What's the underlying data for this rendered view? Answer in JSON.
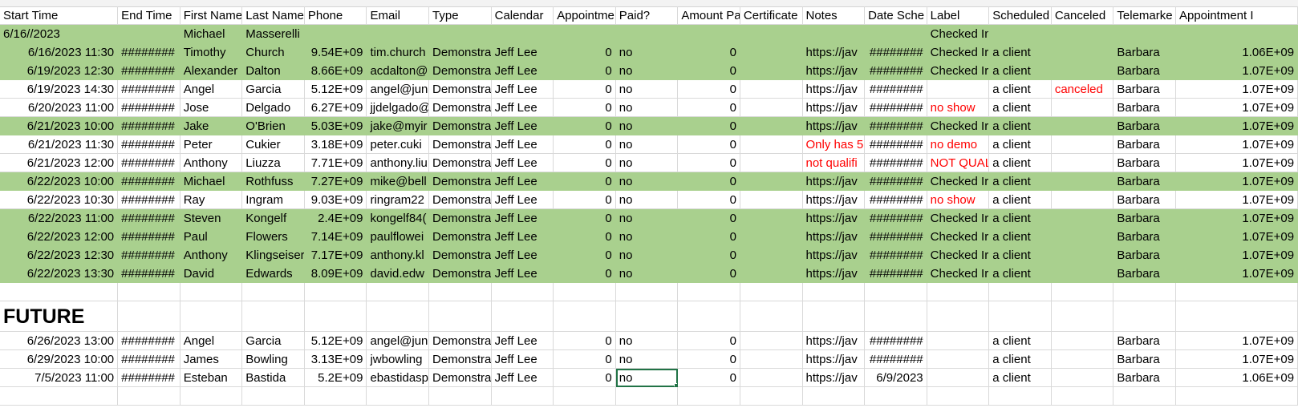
{
  "headers": [
    "Start Time",
    "End Time",
    "First Name",
    "Last Name",
    "Phone",
    "Email",
    "Type",
    "Calendar",
    "Appointme",
    "Paid?",
    "Amount Pa",
    "Certificate",
    "Notes",
    "Date Sche",
    "Label",
    "Scheduled",
    "Canceled",
    "Telemarke",
    "Appointment I"
  ],
  "section_future": "FUTURE",
  "rows": [
    {
      "start": "6/16//2023",
      "end": "",
      "first": "Michael",
      "last": "Masserelli",
      "phone": "",
      "email": "",
      "type": "",
      "cal": "",
      "appt": "",
      "paid": "",
      "amount": "",
      "cert": "",
      "notes": "",
      "date": "",
      "label": "Checked In",
      "sched": "",
      "canceled": "",
      "tele": "",
      "apptid": "",
      "green": true,
      "indent": false
    },
    {
      "start": "6/16/2023 11:30",
      "end": "########",
      "first": "Timothy",
      "last": "Church",
      "phone": "9.54E+09",
      "email": "tim.church",
      "type": "Demonstra",
      "cal": "Jeff Lee",
      "appt": "0",
      "paid": "no",
      "amount": "0",
      "cert": "",
      "notes": "https://jav",
      "date": "########",
      "label": "Checked Ir",
      "sched": "a client",
      "canceled": "",
      "tele": "Barbara",
      "apptid": "1.06E+09",
      "green": true
    },
    {
      "start": "6/19/2023 12:30",
      "end": "########",
      "first": "Alexander",
      "last": "Dalton",
      "phone": "8.66E+09",
      "email": "acdalton@",
      "type": "Demonstra",
      "cal": "Jeff Lee",
      "appt": "0",
      "paid": "no",
      "amount": "0",
      "cert": "",
      "notes": "https://jav",
      "date": "########",
      "label": "Checked Ir",
      "sched": "a client",
      "canceled": "",
      "tele": "Barbara",
      "apptid": "1.07E+09",
      "green": true
    },
    {
      "start": "6/19/2023 14:30",
      "end": "########",
      "first": "Angel",
      "last": "Garcia",
      "phone": "5.12E+09",
      "email": "angel@jun",
      "type": "Demonstra",
      "cal": "Jeff Lee",
      "appt": "0",
      "paid": "no",
      "amount": "0",
      "cert": "",
      "notes": "https://jav",
      "date": "########",
      "label": "",
      "sched": "a client",
      "canceled": "canceled",
      "tele": "Barbara",
      "apptid": "1.07E+09",
      "green": false
    },
    {
      "start": "6/20/2023 11:00",
      "end": "########",
      "first": "Jose",
      "last": "Delgado",
      "phone": "6.27E+09",
      "email": "jjdelgado@",
      "type": "Demonstra",
      "cal": "Jeff Lee",
      "appt": "0",
      "paid": "no",
      "amount": "0",
      "cert": "",
      "notes": "https://jav",
      "date": "########",
      "label": "no show",
      "sched": "a client",
      "canceled": "",
      "tele": "Barbara",
      "apptid": "1.07E+09",
      "green": false,
      "labelRed": true
    },
    {
      "start": "6/21/2023 10:00",
      "end": "########",
      "first": "Jake",
      "last": "O'Brien",
      "phone": "5.03E+09",
      "email": "jake@myir",
      "type": "Demonstra",
      "cal": "Jeff Lee",
      "appt": "0",
      "paid": "no",
      "amount": "0",
      "cert": "",
      "notes": "https://jav",
      "date": "########",
      "label": "Checked Ir",
      "sched": "a client",
      "canceled": "",
      "tele": "Barbara",
      "apptid": "1.07E+09",
      "green": true
    },
    {
      "start": "6/21/2023 11:30",
      "end": "########",
      "first": "Peter",
      "last": "Cukier",
      "phone": "3.18E+09",
      "email": "peter.cuki",
      "type": "Demonstra",
      "cal": "Jeff Lee",
      "appt": "0",
      "paid": "no",
      "amount": "0",
      "cert": "",
      "notes": "Only has 5",
      "date": "########",
      "label": "no demo",
      "sched": "a client",
      "canceled": "",
      "tele": "Barbara",
      "apptid": "1.07E+09",
      "green": false,
      "labelRed": true,
      "notesRed": true
    },
    {
      "start": "6/21/2023 12:00",
      "end": "########",
      "first": "Anthony",
      "last": "Liuzza",
      "phone": "7.71E+09",
      "email": "anthony.liu",
      "type": "Demonstra",
      "cal": "Jeff Lee",
      "appt": "0",
      "paid": "no",
      "amount": "0",
      "cert": "",
      "notes": " not qualifi",
      "date": "########",
      "label": "NOT QUAL",
      "sched": "a client",
      "canceled": "",
      "tele": "Barbara",
      "apptid": "1.07E+09",
      "green": false,
      "labelRed": true,
      "notesRed": true
    },
    {
      "start": "6/22/2023 10:00",
      "end": "########",
      "first": "Michael",
      "last": "Rothfuss",
      "phone": "7.27E+09",
      "email": "mike@bell",
      "type": "Demonstra",
      "cal": "Jeff Lee",
      "appt": "0",
      "paid": "no",
      "amount": "0",
      "cert": "",
      "notes": "https://jav",
      "date": "########",
      "label": "Checked Ir",
      "sched": "a client",
      "canceled": "",
      "tele": "Barbara",
      "apptid": "1.07E+09",
      "green": true
    },
    {
      "start": "6/22/2023 10:30",
      "end": "########",
      "first": "Ray",
      "last": "Ingram",
      "phone": "9.03E+09",
      "email": "ringram22",
      "type": "Demonstra",
      "cal": "Jeff Lee",
      "appt": "0",
      "paid": "no",
      "amount": "0",
      "cert": "",
      "notes": "https://jav",
      "date": "########",
      "label": "no show",
      "sched": "a client",
      "canceled": "",
      "tele": "Barbara",
      "apptid": "1.07E+09",
      "green": false,
      "labelRed": true
    },
    {
      "start": "6/22/2023 11:00",
      "end": "########",
      "first": "Steven",
      "last": "Kongelf",
      "phone": "2.4E+09",
      "email": "kongelf84(",
      "type": "Demonstra",
      "cal": "Jeff Lee",
      "appt": "0",
      "paid": "no",
      "amount": "0",
      "cert": "",
      "notes": "https://jav",
      "date": "########",
      "label": "Checked Ir",
      "sched": "a client",
      "canceled": "",
      "tele": "Barbara",
      "apptid": "1.07E+09",
      "green": true
    },
    {
      "start": "6/22/2023 12:00",
      "end": "########",
      "first": "Paul",
      "last": "Flowers",
      "phone": "7.14E+09",
      "email": "paulflowei",
      "type": "Demonstra",
      "cal": "Jeff Lee",
      "appt": "0",
      "paid": "no",
      "amount": "0",
      "cert": "",
      "notes": "https://jav",
      "date": "########",
      "label": "Checked Ir",
      "sched": "a client",
      "canceled": "",
      "tele": "Barbara",
      "apptid": "1.07E+09",
      "green": true
    },
    {
      "start": "6/22/2023 12:30",
      "end": "########",
      "first": "Anthony",
      "last": "Klingseiser",
      "phone": "7.17E+09",
      "email": "anthony.kl",
      "type": "Demonstra",
      "cal": "Jeff Lee",
      "appt": "0",
      "paid": "no",
      "amount": "0",
      "cert": "",
      "notes": "https://jav",
      "date": "########",
      "label": "Checked Ir",
      "sched": "a client",
      "canceled": "",
      "tele": "Barbara",
      "apptid": "1.07E+09",
      "green": true
    },
    {
      "start": "6/22/2023 13:30",
      "end": "########",
      "first": "David",
      "last": "Edwards",
      "phone": "8.09E+09",
      "email": "david.edw",
      "type": "Demonstra",
      "cal": "Jeff Lee",
      "appt": "0",
      "paid": "no",
      "amount": "0",
      "cert": "",
      "notes": "https://jav",
      "date": "########",
      "label": "Checked Ir",
      "sched": "a client",
      "canceled": "",
      "tele": "Barbara",
      "apptid": "1.07E+09",
      "green": true
    }
  ],
  "future_rows": [
    {
      "start": "6/26/2023 13:00",
      "end": "########",
      "first": "Angel",
      "last": "Garcia",
      "phone": "5.12E+09",
      "email": "angel@jun",
      "type": "Demonstra",
      "cal": "Jeff Lee",
      "appt": "0",
      "paid": "no",
      "amount": "0",
      "cert": "",
      "notes": "https://jav",
      "date": "########",
      "label": "",
      "sched": "a client",
      "canceled": "",
      "tele": "Barbara",
      "apptid": "1.07E+09"
    },
    {
      "start": "6/29/2023 10:00",
      "end": "########",
      "first": "James",
      "last": "Bowling",
      "phone": "3.13E+09",
      "email": "jwbowling",
      "type": "Demonstra",
      "cal": "Jeff Lee",
      "appt": "0",
      "paid": "no",
      "amount": "0",
      "cert": "",
      "notes": "https://jav",
      "date": "########",
      "label": "",
      "sched": "a client",
      "canceled": "",
      "tele": "Barbara",
      "apptid": "1.07E+09"
    },
    {
      "start": "7/5/2023 11:00",
      "end": "########",
      "first": "Esteban",
      "last": "Bastida",
      "phone": "5.2E+09",
      "email": "ebastidasp",
      "type": "Demonstra",
      "cal": "Jeff Lee",
      "appt": "0",
      "paid": "no",
      "amount": "0",
      "cert": "",
      "notes": "https://jav",
      "date": "6/9/2023",
      "label": "",
      "sched": "a client",
      "canceled": "",
      "tele": "Barbara",
      "apptid": "1.06E+09",
      "selectedPaid": true
    }
  ],
  "colors": {
    "green": "#a9d08e",
    "red": "#ff0000",
    "selection": "#217346"
  }
}
